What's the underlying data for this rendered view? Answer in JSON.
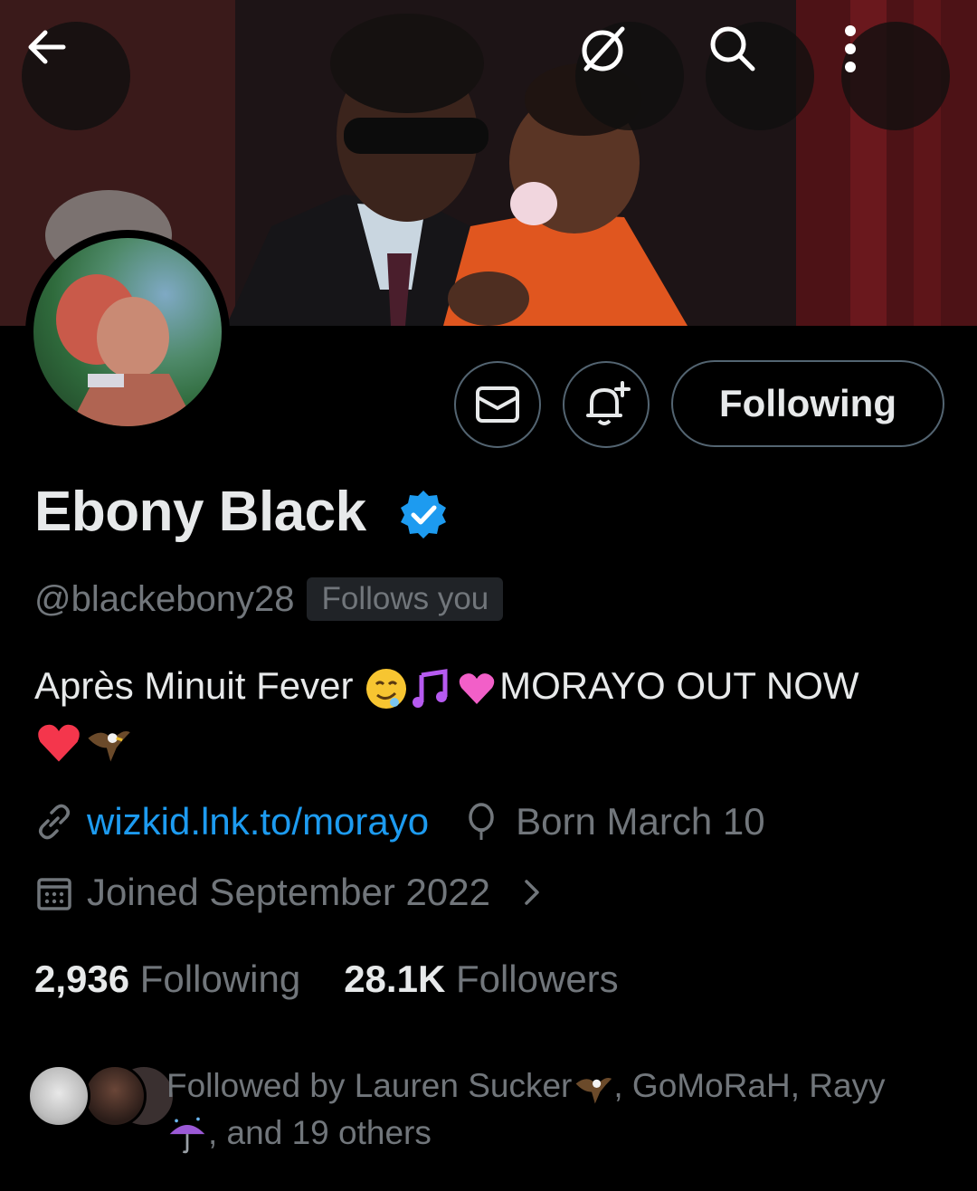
{
  "header": {
    "back_icon": "back-arrow-icon",
    "grok_icon": "grok-icon",
    "search_icon": "search-icon",
    "more_icon": "more-vertical-icon"
  },
  "actions": {
    "message_icon": "mail-icon",
    "notify_icon": "bell-plus-icon",
    "following_label": "Following"
  },
  "profile": {
    "name": "Ebony Black",
    "verified": true,
    "handle": "@blackebony28",
    "follows_you": "Follows you",
    "bio_text_1": "Après Minuit Fever ",
    "bio_text_2": "MORAYO OUT NOW",
    "link": "wizkid.lnk.to/morayo",
    "born": "Born March 10",
    "joined": "Joined September 2022"
  },
  "stats": {
    "following_count": "2,936",
    "following_label": "Following",
    "followers_count": "28.1K",
    "followers_label": "Followers"
  },
  "followed_by": {
    "prefix": "Followed by Lauren Sucker",
    "middle": ", GoMoRaH, Rayy",
    "suffix": ", and 19 others"
  },
  "colors": {
    "accent": "#1d9bf0",
    "muted": "#71767b",
    "text": "#e7e9ea",
    "border": "#536471"
  }
}
